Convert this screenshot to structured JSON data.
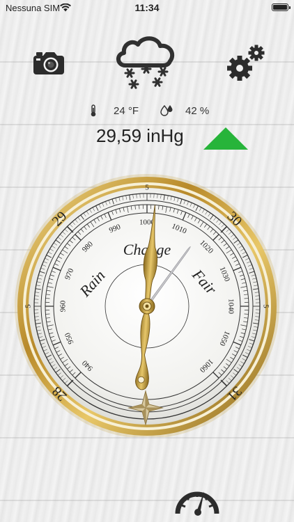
{
  "status": {
    "carrier": "Nessuna SIM",
    "time": "11:34"
  },
  "toolbar": {
    "camera_icon": "camera-icon",
    "weather_icon": "snow-cloud-icon",
    "settings_icon": "gears-icon"
  },
  "readings": {
    "temperature": "24 °F",
    "humidity": "42 %",
    "pressure": "29,59 inHg",
    "trend": "rising",
    "trend_color": "#27b43a"
  },
  "gauge": {
    "words": {
      "rain": "Rain",
      "change": "Change",
      "fair": "Fair"
    },
    "hpa_labels": [
      "940",
      "950",
      "960",
      "970",
      "980",
      "990",
      "1000",
      "1010",
      "1020",
      "1030",
      "1040",
      "1050",
      "1060"
    ],
    "inhg_labels": [
      "28",
      "5",
      "29",
      "5",
      "30",
      "5",
      "31"
    ],
    "pointer_value_hpa": 1002,
    "reference_value_hpa": 1016
  },
  "bottom": {
    "icon": "speedometer-icon"
  }
}
